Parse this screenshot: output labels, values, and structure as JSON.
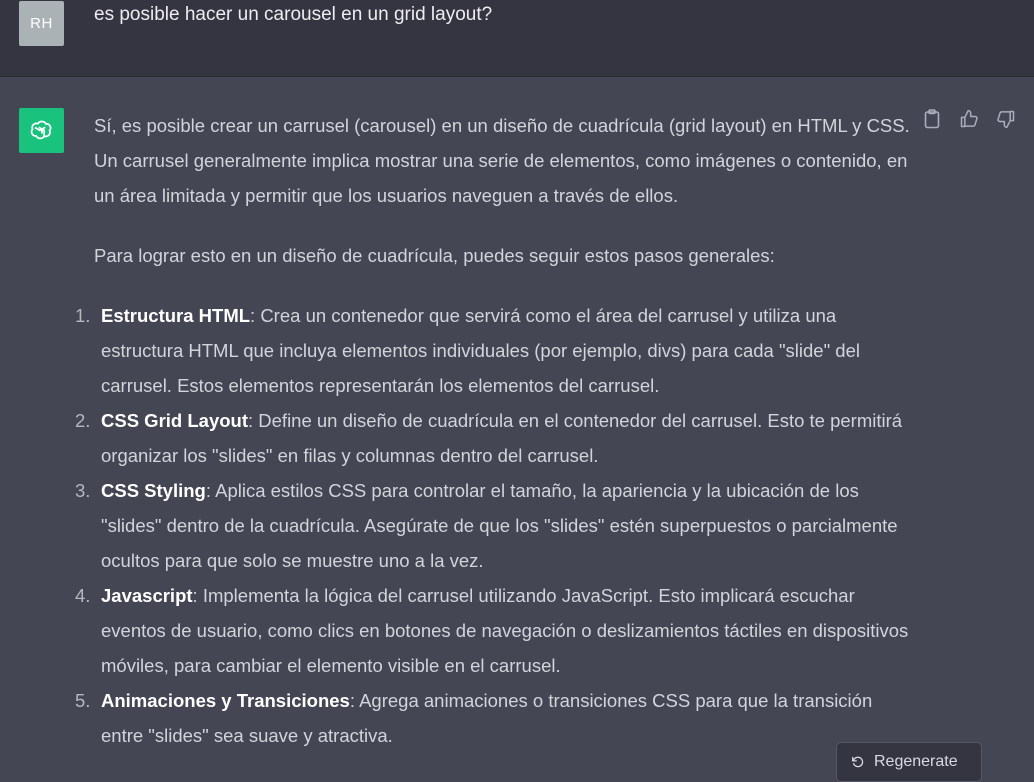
{
  "user": {
    "avatar_initials": "RH",
    "message": "es posible hacer un carousel en un grid layout?"
  },
  "assistant": {
    "avatar_icon": "openai-logo-icon",
    "avatar_color": "#19c37d",
    "paragraphs": [
      "Sí, es posible crear un carrusel (carousel) en un diseño de cuadrícula (grid layout) en HTML y CSS. Un carrusel generalmente implica mostrar una serie de elementos, como imágenes o contenido, en un área limitada y permitir que los usuarios naveguen a través de ellos.",
      "Para lograr esto en un diseño de cuadrícula, puedes seguir estos pasos generales:"
    ],
    "steps": [
      {
        "num": "1.",
        "title": "Estructura HTML",
        "text": ": Crea un contenedor que servirá como el área del carrusel y utiliza una estructura HTML que incluya elementos individuales (por ejemplo, divs) para cada \"slide\" del carrusel. Estos elementos representarán los elementos del carrusel."
      },
      {
        "num": "2.",
        "title": "CSS Grid Layout",
        "text": ": Define un diseño de cuadrícula en el contenedor del carrusel. Esto te permitirá organizar los \"slides\" en filas y columnas dentro del carrusel."
      },
      {
        "num": "3.",
        "title": "CSS Styling",
        "text": ": Aplica estilos CSS para controlar el tamaño, la apariencia y la ubicación de los \"slides\" dentro de la cuadrícula. Asegúrate de que los \"slides\" estén superpuestos o parcialmente ocultos para que solo se muestre uno a la vez."
      },
      {
        "num": "4.",
        "title": "Javascript",
        "text": ": Implementa la lógica del carrusel utilizando JavaScript. Esto implicará escuchar eventos de usuario, como clics en botones de navegación o deslizamientos táctiles en dispositivos móviles, para cambiar el elemento visible en el carrusel."
      },
      {
        "num": "5.",
        "title": "Animaciones y Transiciones",
        "text": ": Agrega animaciones o transiciones CSS para que la transición entre \"slides\" sea suave y atractiva."
      }
    ],
    "actions": [
      "copy-icon",
      "thumbs-up-icon",
      "thumbs-down-icon"
    ]
  },
  "regenerate": {
    "label": "Regenerate",
    "icon": "regenerate-icon"
  },
  "colors": {
    "user_bg": "#343541",
    "assistant_bg": "#444654",
    "text": "#d1d5db"
  }
}
